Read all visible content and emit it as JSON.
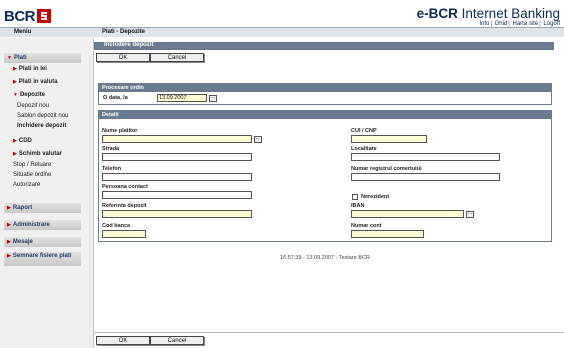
{
  "header": {
    "logo_text": "BCR",
    "brand_prefix": "e-BCR",
    "brand_suffix": "Internet Banking",
    "links": [
      "Info",
      "Ghid",
      "Harta site",
      "Logoff"
    ]
  },
  "menubar": {
    "menu_label": "Meniu",
    "page_label": "Plati - Depozite"
  },
  "sidebar": {
    "plati": "Plati",
    "plati_lei": "Plati in lei",
    "plati_valuta": "Plati in valuta",
    "depozite": "Depozite",
    "depozit_nou": "Depozit nou",
    "sablon": "Sablon depozit nou",
    "inchidere": "Inchidere depozit",
    "cdd": "CDD",
    "schimb": "Schimb valutar",
    "stop": "Stop / Reluare",
    "situatie": "Situatie ordine",
    "autorizare": "Autorizare",
    "raport": "Raport",
    "administrare": "Administrare",
    "mesaje": "Mesaje",
    "semnare": "Semnare fisiere plati"
  },
  "page": {
    "title": "Inchidere depozit",
    "ok_label": "OK",
    "cancel_label": "Cancel"
  },
  "procesare": {
    "heading": "Procesare ordin",
    "date_label": "O data, la",
    "date_value": "13.09.2007"
  },
  "detalii": {
    "heading": "Detalii",
    "nume_platitor": "Nume platitor",
    "strada": "Strada",
    "telefon": "Telefon",
    "persoana_contact": "Persoana contact",
    "referinta": "Referinta depozit",
    "cod_banca": "Cod banca",
    "cui": "CUI / CNP",
    "localitate": "Localitate",
    "nr_registru": "Numar registrul comertului",
    "nerezident": "Nerezident",
    "iban": "IBAN",
    "numar_cont": "Numar cont"
  },
  "footer": {
    "timestamp": "16:57:39 - 13.09.2007 - Testare BCR"
  },
  "colors": {
    "brand_blue": "#0d2a5c",
    "accent_red": "#cc0000",
    "section_header": "#6a7a90",
    "required_field": "#ffffd6"
  }
}
